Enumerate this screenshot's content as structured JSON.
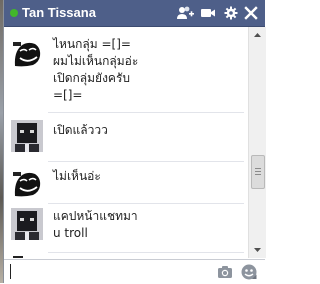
{
  "chat": {
    "title": "Tan Tissana",
    "status": "online",
    "status_color": "#42b72a",
    "header_color": "#4e5f89",
    "header_icons": [
      "add-friends-icon",
      "video-call-icon",
      "gear-icon",
      "close-icon"
    ]
  },
  "messages": [
    {
      "avatar": "troll-avatar",
      "lines": [
        "ไหนกลุ่ม =[]=",
        "ผมไม่เห็นกลุ่มอ่ะ",
        "เปิดกลุ่มยังครับ",
        "=[]="
      ]
    },
    {
      "avatar": "robot-avatar",
      "lines": [
        "เปิดแล้ววว"
      ]
    },
    {
      "avatar": "troll-avatar",
      "lines": [
        "ไม่เห็นอ่ะ"
      ]
    },
    {
      "avatar": "robot-avatar",
      "lines": [
        "แคปหน้าแชทมา",
        "u troll"
      ]
    },
    {
      "avatar": "troll-avatar",
      "lines": []
    }
  ],
  "composer": {
    "value": "",
    "icons": [
      "camera-icon",
      "sticker-icon"
    ]
  }
}
